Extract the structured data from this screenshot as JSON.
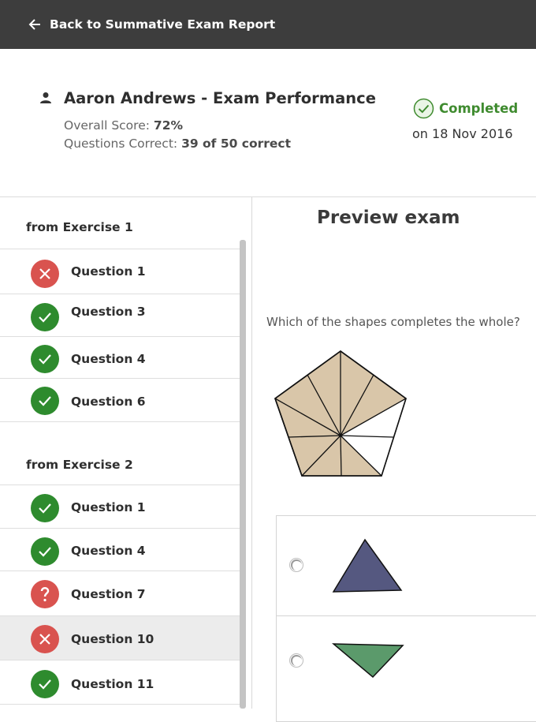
{
  "topbar": {
    "back_label": "Back to Summative Exam Report"
  },
  "header": {
    "student_title": "Aaron Andrews - Exam Performance",
    "overall_score_label": "Overall Score:",
    "overall_score_value": "72%",
    "questions_correct_label": "Questions Correct:",
    "questions_correct_value": "39 of 50 correct",
    "status": "Completed",
    "status_date": "on 18 Nov 2016"
  },
  "sidebar": {
    "sections": [
      {
        "title": "from Exercise 1",
        "questions": [
          {
            "label": "Question 1",
            "status": "wrong"
          },
          {
            "label": "Question 3",
            "status": "correct"
          },
          {
            "label": "Question 4",
            "status": "correct"
          },
          {
            "label": "Question 6",
            "status": "correct"
          }
        ]
      },
      {
        "title": "from Exercise 2",
        "questions": [
          {
            "label": "Question 1",
            "status": "correct"
          },
          {
            "label": "Question 4",
            "status": "correct"
          },
          {
            "label": "Question 7",
            "status": "unanswered"
          },
          {
            "label": "Question 10",
            "status": "wrong",
            "selected": true
          },
          {
            "label": "Question 11",
            "status": "correct"
          }
        ]
      }
    ]
  },
  "preview": {
    "title": "Preview exam",
    "question_text": "Which of the shapes completes the whole?",
    "answers": [
      {
        "shape": "triangle-up",
        "fill": "#555880"
      },
      {
        "shape": "triangle-down",
        "fill": "#5b9a6b"
      }
    ]
  },
  "colors": {
    "topbar": "#3d3d3d",
    "correct": "#2e8b2e",
    "wrong": "#d9534f",
    "completed": "#3f8b2f",
    "pentagon_fill": "#d9c6a9"
  }
}
